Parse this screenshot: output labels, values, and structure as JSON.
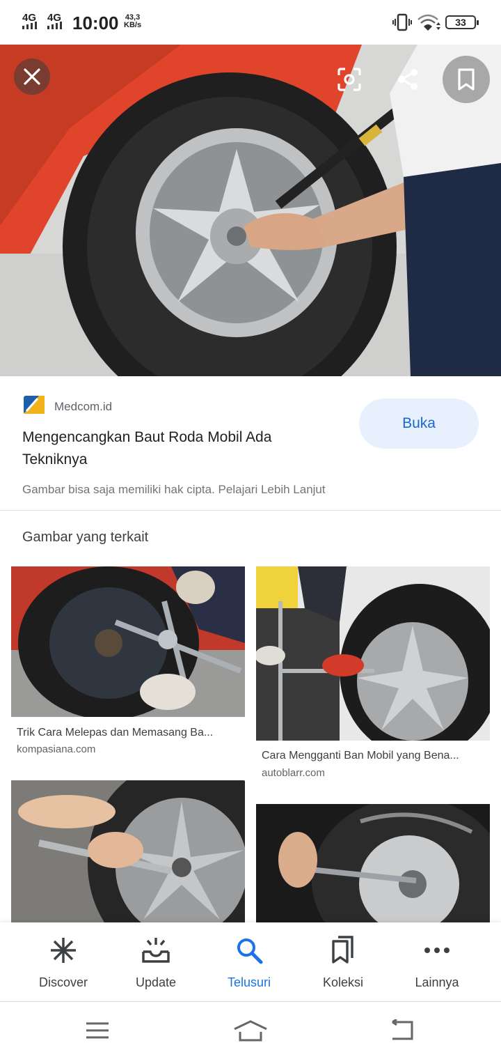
{
  "status_bar": {
    "network1": "4G",
    "network2": "4G",
    "time": "10:00",
    "speed_value": "43,3",
    "speed_unit": "KB/s",
    "battery": "33"
  },
  "hero": {
    "close_icon": "close-icon",
    "lens_icon": "lens-icon",
    "share_icon": "share-icon",
    "save_icon": "bookmark-icon"
  },
  "result": {
    "source": "Medcom.id",
    "title": "Mengencangkan Baut Roda Mobil Ada Tekniknya",
    "open_label": "Buka",
    "copyright": "Gambar bisa saja memiliki hak cipta. Pelajari Lebih Lanjut"
  },
  "related": {
    "heading": "Gambar yang terkait",
    "items": [
      {
        "caption": "Trik Cara Melepas dan Memasang Ba...",
        "domain": "kompasiana.com"
      },
      {
        "caption": "Cara Mengganti Ban Mobil yang Bena...",
        "domain": "autoblarr.com"
      },
      {
        "caption": "",
        "domain": ""
      },
      {
        "caption": "",
        "domain": ""
      }
    ]
  },
  "bottom_nav": [
    {
      "label": "Discover",
      "icon": "asterisk-icon"
    },
    {
      "label": "Update",
      "icon": "inbox-icon"
    },
    {
      "label": "Telusuri",
      "icon": "search-icon"
    },
    {
      "label": "Koleksi",
      "icon": "collections-icon"
    },
    {
      "label": "Lainnya",
      "icon": "more-icon"
    }
  ],
  "colors": {
    "accent": "#1a73e8",
    "button_bg": "#e8f0fe",
    "button_text": "#1967d2"
  }
}
